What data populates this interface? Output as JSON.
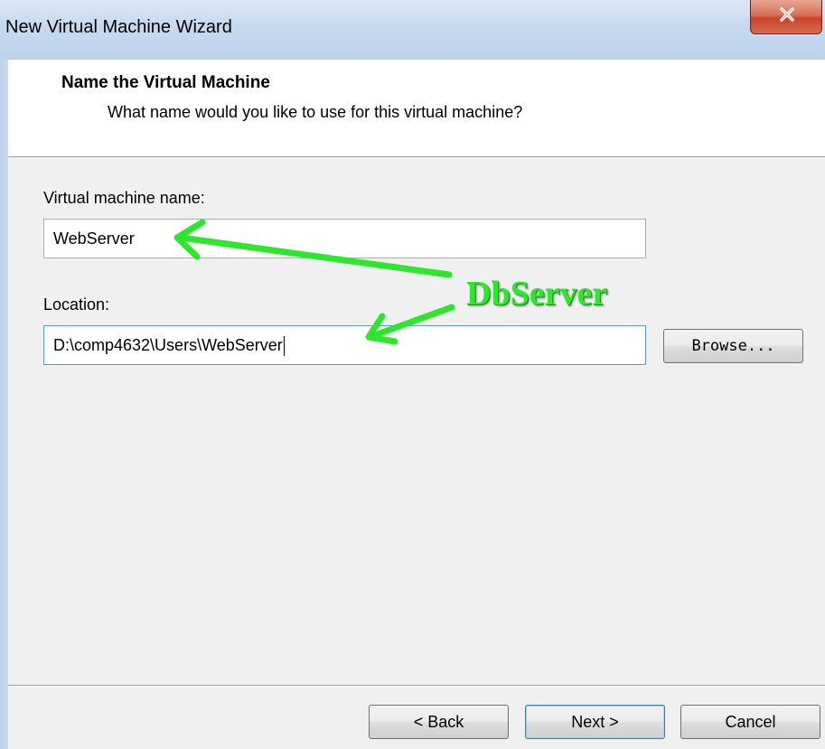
{
  "window": {
    "title": "New Virtual Machine Wizard",
    "close_icon": "close-icon"
  },
  "header": {
    "title": "Name the Virtual Machine",
    "subtitle": "What name would you like to use for this virtual machine?"
  },
  "form": {
    "name_label": "Virtual machine name:",
    "name_value": "WebServer",
    "location_label": "Location:",
    "location_value": "D:\\comp4632\\Users\\WebServer",
    "browse_label": "Browse..."
  },
  "annotation": {
    "text": "DbServer",
    "color": "#2ee62e"
  },
  "footer": {
    "back_label": "< Back",
    "next_label": "Next >",
    "cancel_label": "Cancel"
  }
}
